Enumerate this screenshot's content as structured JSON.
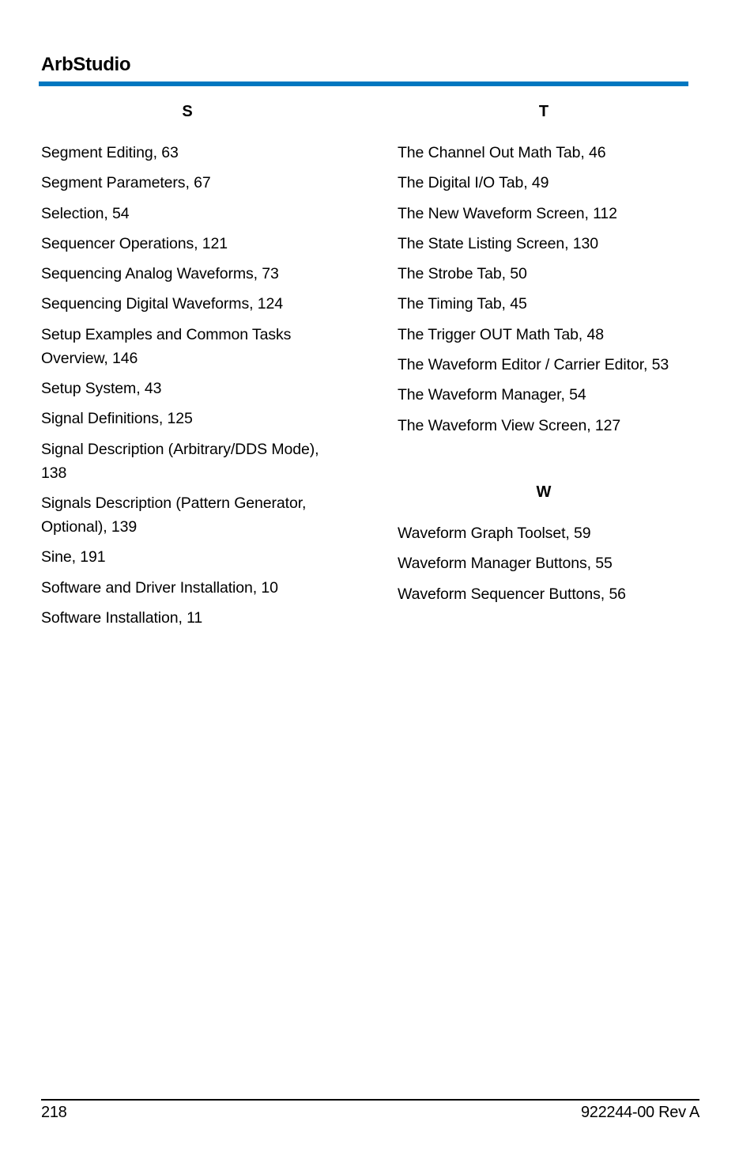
{
  "header": {
    "title": "ArbStudio",
    "accent_color": "#0077c0"
  },
  "index": {
    "left_column": [
      {
        "letter": "S",
        "entries": [
          "Segment Editing, 63",
          "Segment Parameters, 67",
          "Selection, 54",
          "Sequencer Operations, 121",
          "Sequencing Analog Waveforms, 73",
          "Sequencing Digital Waveforms, 124",
          "Setup Examples and Common Tasks Overview, 146",
          "Setup System, 43",
          "Signal Definitions, 125",
          "Signal Description (Arbitrary/DDS Mode), 138",
          "Signals Description (Pattern Generator, Optional), 139",
          "Sine, 191",
          "Software and Driver Installation, 10",
          "Software Installation, 11"
        ]
      }
    ],
    "right_column": [
      {
        "letter": "T",
        "entries": [
          "The Channel Out Math Tab, 46",
          "The Digital I/O Tab, 49",
          "The New Waveform Screen, 112",
          "The State Listing Screen, 130",
          "The Strobe Tab, 50",
          "The Timing Tab, 45",
          "The Trigger OUT Math Tab, 48",
          "The Waveform Editor / Carrier Editor, 53",
          "The Waveform Manager, 54",
          "The Waveform View Screen, 127"
        ]
      },
      {
        "letter": "W",
        "entries": [
          "Waveform Graph Toolset, 59",
          "Waveform Manager Buttons, 55",
          "Waveform Sequencer Buttons, 56"
        ]
      }
    ]
  },
  "footer": {
    "page_number": "218",
    "doc_id": "922244-00 Rev A"
  }
}
